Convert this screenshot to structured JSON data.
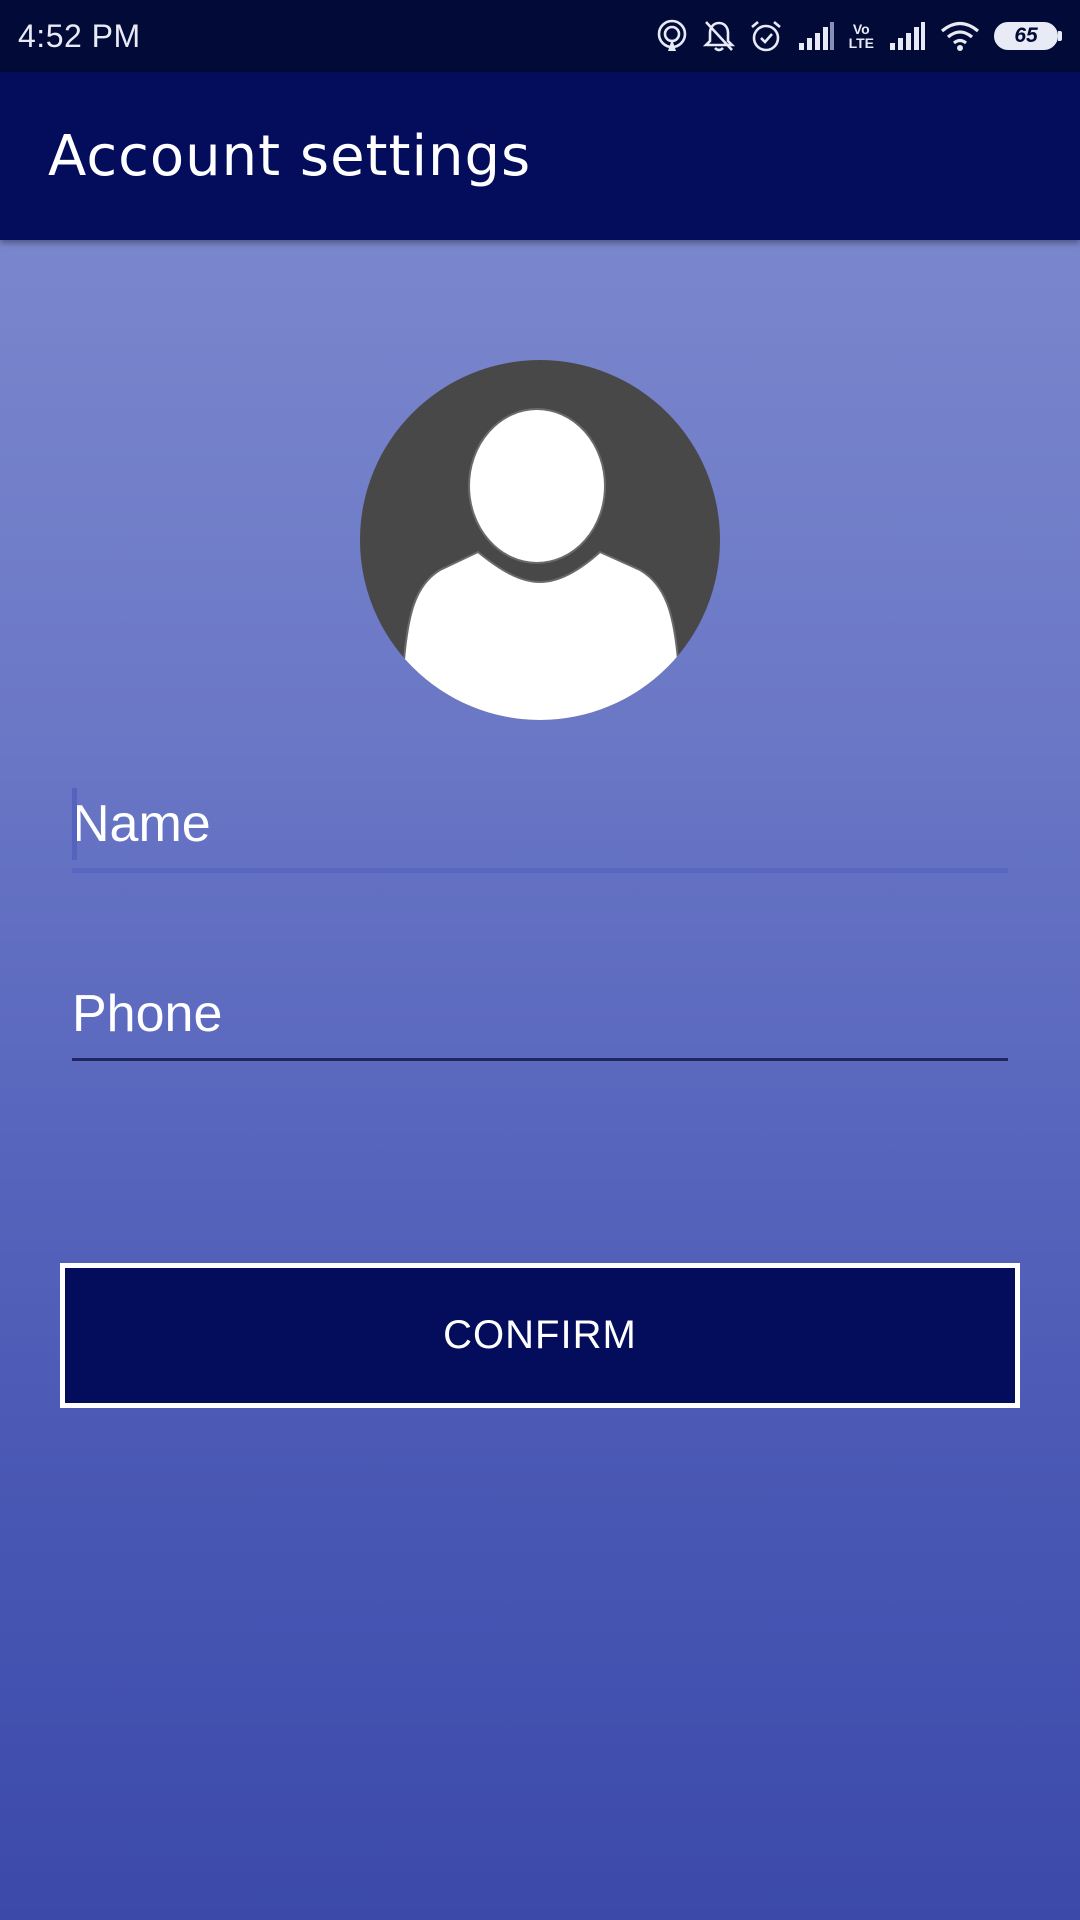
{
  "status_bar": {
    "time": "4:52 PM",
    "battery_level": "65",
    "icons": [
      "hotspot-icon",
      "bell-off-icon",
      "alarm-icon",
      "signal-icon",
      "volte-icon",
      "signal-icon",
      "wifi-icon",
      "battery-icon"
    ],
    "volte_label_top": "Vo",
    "volte_label_bottom": "LTE"
  },
  "app_bar": {
    "title": "Account settings"
  },
  "profile": {
    "avatar_icon": "person-silhouette-icon"
  },
  "form": {
    "name_placeholder": "Name",
    "phone_placeholder": "Phone",
    "confirm_label": "CONFIRM"
  },
  "colors": {
    "status_bar_bg": "#020a38",
    "app_bar_bg": "#040d5c",
    "gradient_top": "#7a86cc",
    "gradient_bottom": "#3c49a9",
    "button_bg": "#040d5c",
    "avatar_bg": "#484848"
  }
}
